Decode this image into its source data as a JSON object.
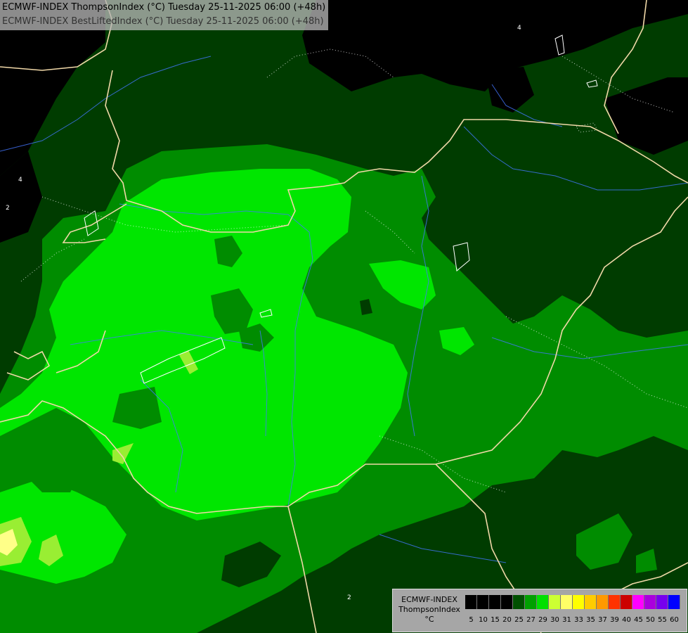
{
  "header": {
    "line1": "ECMWF-INDEX ThompsonIndex (°C) Tuesday 25-11-2025 06:00 (+48h)",
    "line2": "ECMWF-INDEX BestLiftedIndex (°C) Tuesday 25-11-2025 06:00 (+48h)"
  },
  "legend": {
    "title": [
      "ECMWF-INDEX",
      "ThompsonIndex",
      "°C"
    ],
    "colors": [
      "#000000",
      "#000000",
      "#000000",
      "#000000",
      "#005000",
      "#00a000",
      "#00e000",
      "#ccff33",
      "#ffff66",
      "#ffff00",
      "#ffcc00",
      "#ff9900",
      "#ff3300",
      "#cc0000",
      "#ff00ff",
      "#aa00dd",
      "#7700ee",
      "#0000ff"
    ],
    "ticks": [
      "5",
      "10",
      "15",
      "20",
      "25",
      "27",
      "29",
      "30",
      "31",
      "33",
      "35",
      "37",
      "39",
      "40",
      "45",
      "50",
      "55",
      "60"
    ]
  },
  "map": {
    "contour_labels": [
      "4",
      "2",
      "4",
      "2",
      "4"
    ]
  },
  "colors": {
    "bg_black": "#000000",
    "dark_green": "#003c00",
    "mid_green": "#008c00",
    "bright_green": "#00e600",
    "lime": "#99ee33",
    "yellow": "#ffff88",
    "border": "#f0d8a8",
    "river": "#4477ff"
  }
}
